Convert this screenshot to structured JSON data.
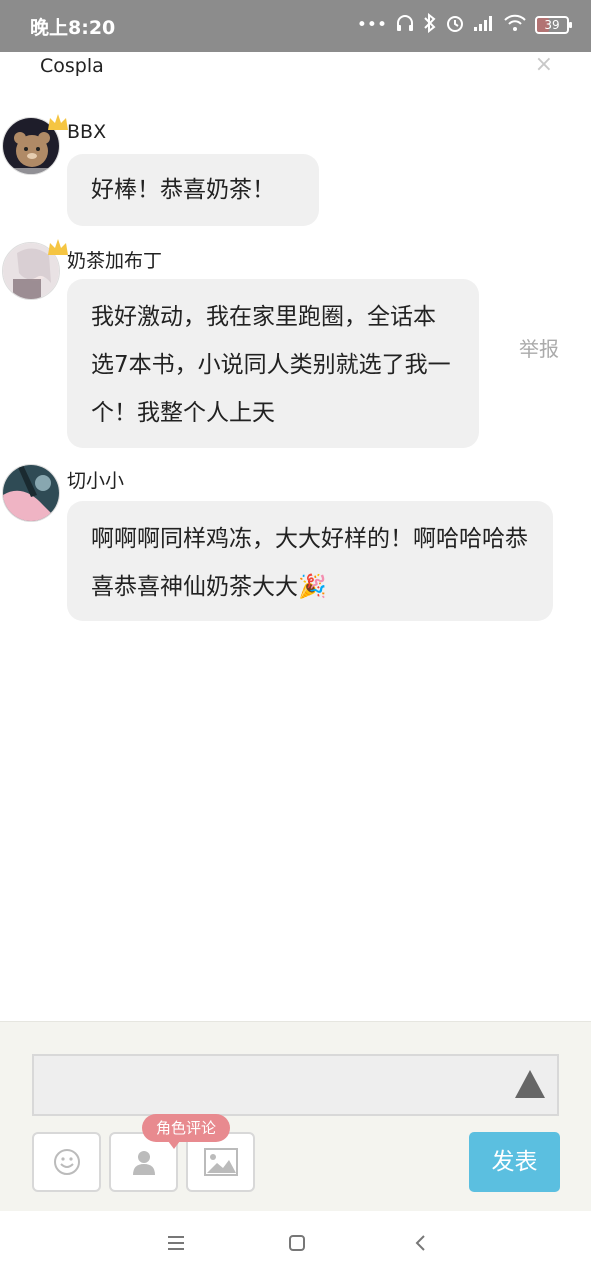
{
  "status_bar": {
    "time": "晚上8:20",
    "battery": "39",
    "battery_level": 0.39,
    "icons": [
      "more-dots-icon",
      "headset-icon",
      "bluetooth-icon",
      "alarm-icon",
      "signal-icon",
      "wifi-icon",
      "battery-icon"
    ]
  },
  "header": {
    "title": "Cospla",
    "close": "×"
  },
  "messages": [
    {
      "user": "BBX",
      "text": "好棒！恭喜奶茶！",
      "has_crown": true
    },
    {
      "user": "奶茶加布丁",
      "text": "我好激动，我在家里跑圈，全话本选7本书，小说同人类别就选了我一个！我整个人上天",
      "has_crown": true,
      "report": "举报"
    },
    {
      "user": "切小小",
      "text": "啊啊啊同样鸡冻，大大好样的！啊哈哈哈恭喜恭喜神仙奶茶大大🎉",
      "has_crown": false
    }
  ],
  "composer": {
    "input_value": "",
    "role_comment_tip": "角色评论",
    "send_label": "发表",
    "tools": [
      "emoji-icon",
      "person-icon",
      "image-icon"
    ]
  },
  "colors": {
    "send": "#5bbfe0",
    "tip": "#e88a8f",
    "bubble": "#f0f0f0",
    "crown": "#f5c542"
  }
}
